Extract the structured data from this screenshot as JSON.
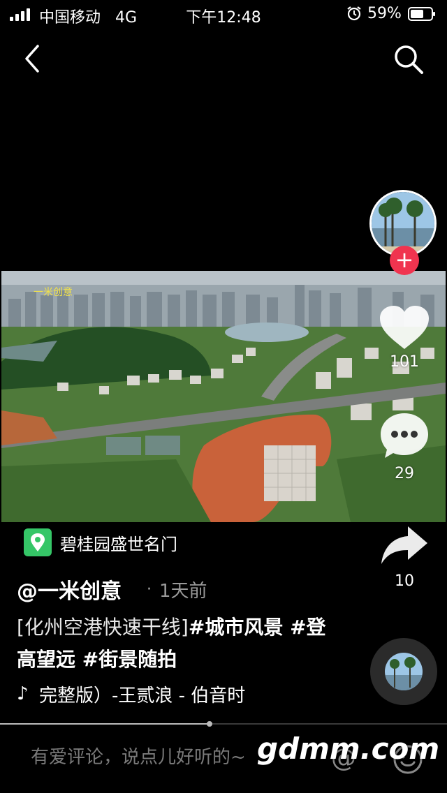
{
  "status_bar": {
    "carrier": "中国移动",
    "network": "4G",
    "time": "下午12:48",
    "battery": "59%",
    "signal_icon": "signal-bars-icon",
    "alarm_icon": "alarm-clock-icon",
    "battery_icon": "battery-icon"
  },
  "nav": {
    "back_icon": "chevron-left-icon",
    "search_icon": "search-icon"
  },
  "video": {
    "watermark": "一米创意"
  },
  "sidebar": {
    "follow_label": "+",
    "likes": "101",
    "comments": "29",
    "shares": "10"
  },
  "location": {
    "name": "碧桂园盛世名门"
  },
  "post": {
    "author": "@一米创意",
    "dot": "·",
    "time_ago": "1天前",
    "caption_prefix": "[化州空港快速干线]",
    "caption_tags": "#城市风景 #登高望远 #街景随拍",
    "music_note": "♪",
    "music": "完整版）-王贰浪 - 伯音时"
  },
  "progress": {
    "fraction": 0.47
  },
  "comment_bar": {
    "placeholder": "有爱评论，说点儿好听的~",
    "at_label": "@"
  },
  "watermark": "gdmm.com",
  "colors": {
    "background": "#000000",
    "follow": "#f0344f",
    "location_pin": "#35c667",
    "video_watermark": "#f2e24a"
  }
}
